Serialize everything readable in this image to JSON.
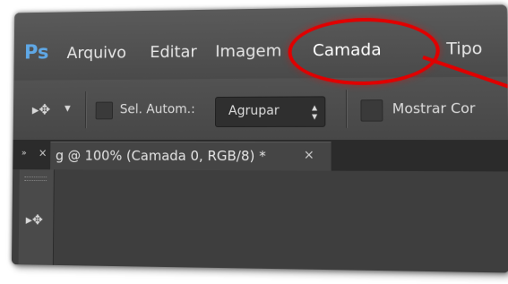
{
  "menubar": {
    "logo": "Ps",
    "items": [
      {
        "label": "Arquivo"
      },
      {
        "label": "Editar"
      },
      {
        "label": "Imagem"
      },
      {
        "label": "Camada"
      },
      {
        "label": "Tipo"
      }
    ]
  },
  "options": {
    "auto_select_label": "Sel. Autom.:",
    "auto_select_value": "Agrupar",
    "show_label": "Mostrar Cor"
  },
  "document": {
    "tab_title": "g @ 100% (Camada 0, RGB/8) *"
  },
  "annotation": {
    "highlight_color": "#e00000"
  }
}
